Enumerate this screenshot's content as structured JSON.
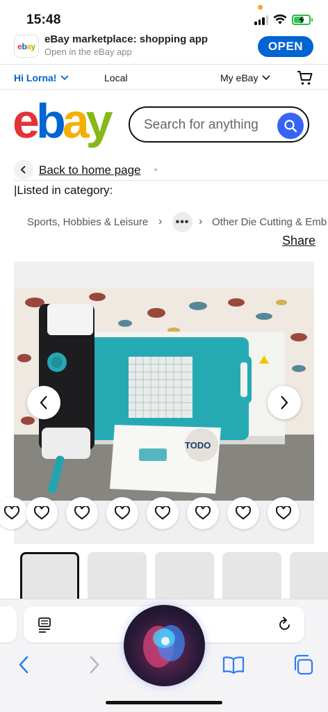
{
  "status_bar": {
    "time": "15:48"
  },
  "app_banner": {
    "logo_text": "ebay",
    "title": "eBay marketplace: shopping app",
    "subtitle": "Open in the eBay app",
    "open_label": "OPEN"
  },
  "nav": {
    "greeting": "Hi Lorna!",
    "local": "Local",
    "my_ebay": "My eBay"
  },
  "logo": {
    "e": "e",
    "b": "b",
    "a": "a",
    "y": "y"
  },
  "search": {
    "placeholder": "Search for anything"
  },
  "back": {
    "label": "Back to home page"
  },
  "listed_in": "|Listed in category:",
  "breadcrumb": {
    "first": "Sports, Hobbies & Leisure",
    "more": "•••",
    "last": "Other Die Cutting & Emb"
  },
  "share_label": "Share",
  "gallery": {
    "heart_count": 7,
    "thumbnail_count": 5,
    "selected_thumbnail": 1
  },
  "colors": {
    "ebay_red": "#e53238",
    "ebay_blue": "#0064d2",
    "ebay_yellow": "#f5af02",
    "ebay_green": "#86b817",
    "search_button": "#3665f3",
    "safari_blue": "#2c7cf6"
  },
  "icons": [
    "signal-icon",
    "wifi-icon",
    "battery-icon",
    "chevron-down-icon",
    "cart-icon",
    "search-icon",
    "chevron-left-icon",
    "chevron-right-icon",
    "heart-icon",
    "reader-icon",
    "reload-icon",
    "bookmarks-icon",
    "tabs-icon",
    "siri-icon"
  ]
}
